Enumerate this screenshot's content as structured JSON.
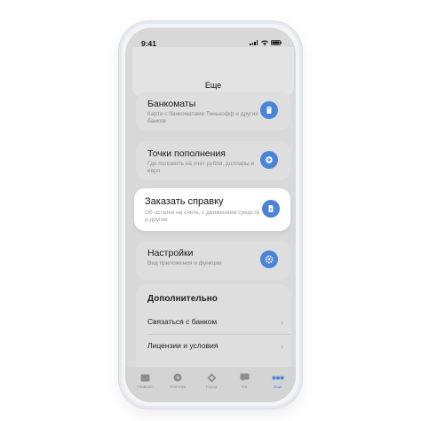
{
  "status": {
    "time": "9:41"
  },
  "header": {
    "title": "Еще"
  },
  "cards": [
    {
      "title": "Банкоматы",
      "subtitle": "Карта с банкоматами Тинькофф и других банков",
      "icon": "card-map-icon"
    },
    {
      "title": "Точки пополнения",
      "subtitle": "Где положить на счет рубли, доллары и евро",
      "icon": "plus-icon"
    },
    {
      "title": "Заказать справку",
      "subtitle": "Об остатке на счете, с движением средств и другие",
      "icon": "document-icon"
    },
    {
      "title": "Настройки",
      "subtitle": "Вид приложения и функции",
      "icon": "gear-icon"
    }
  ],
  "more": {
    "title": "Дополнительно",
    "items": [
      {
        "label": "Связаться с банком"
      },
      {
        "label": "Лицензии и условия"
      }
    ]
  },
  "tabbar": [
    {
      "label": "Главная",
      "icon": "home-icon"
    },
    {
      "label": "Платежи",
      "icon": "payments-icon"
    },
    {
      "label": "Город",
      "icon": "city-icon"
    },
    {
      "label": "Чат",
      "icon": "chat-icon"
    },
    {
      "label": "Еще",
      "icon": "more-dots-icon",
      "active": true
    }
  ],
  "colors": {
    "accent": "#4a84d9",
    "active_card": "#ffffff"
  }
}
